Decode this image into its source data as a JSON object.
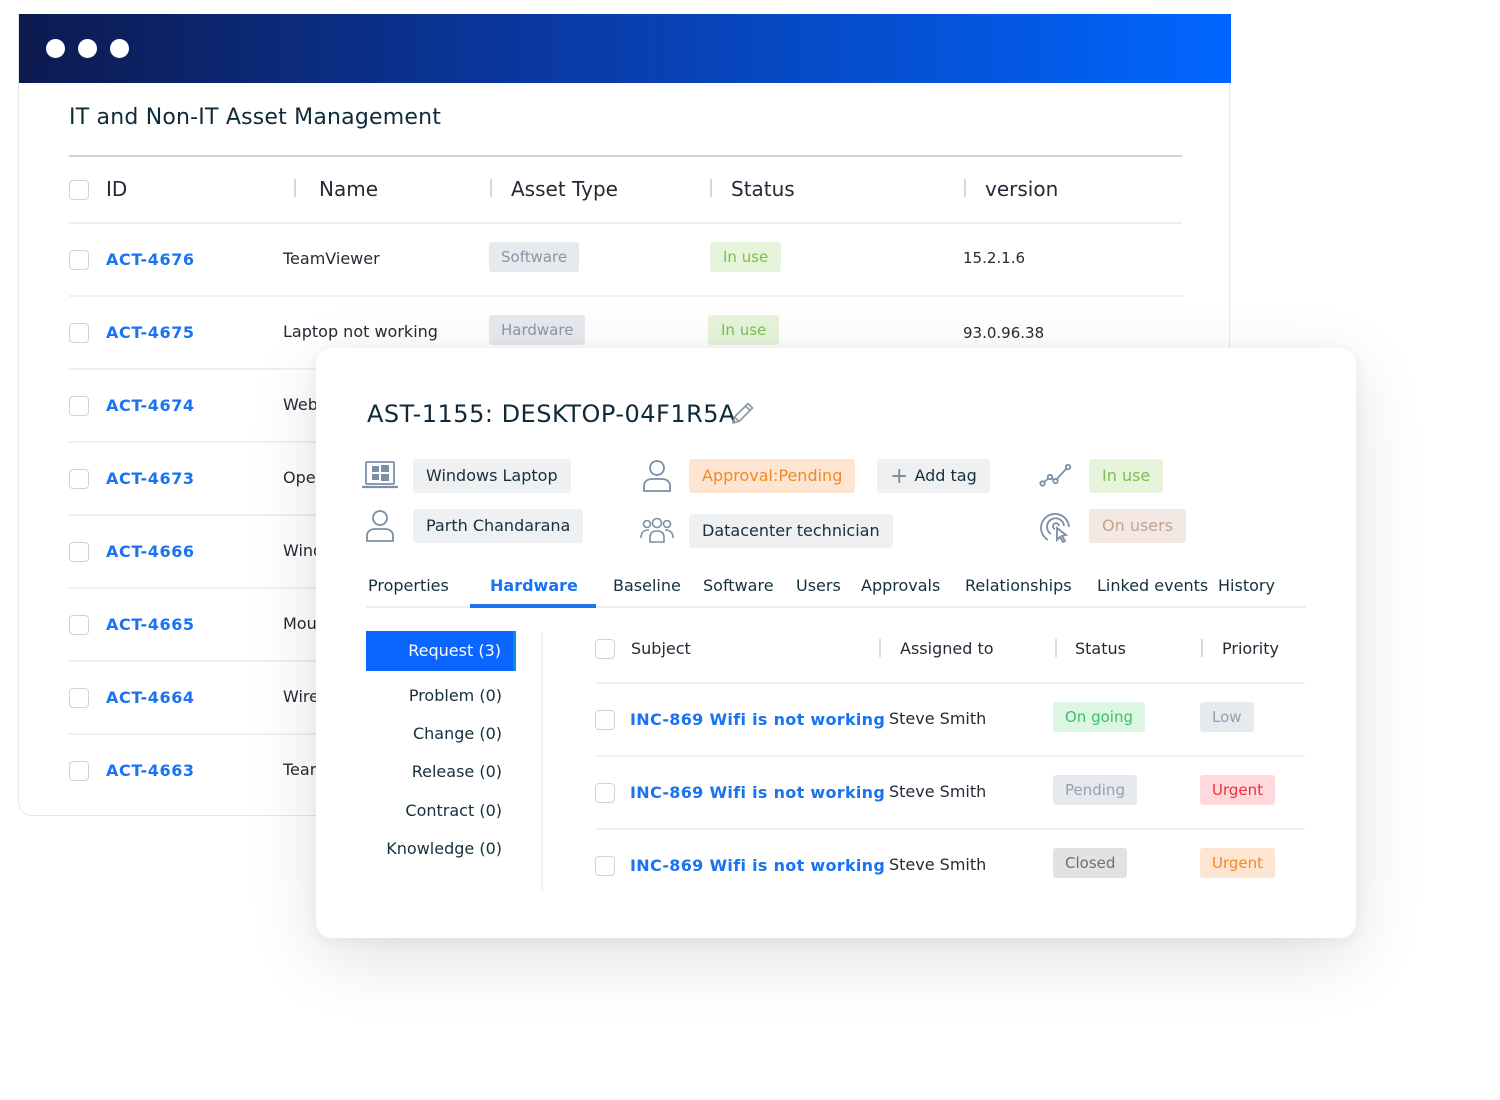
{
  "window": {
    "title": "IT and Non-IT Asset Management",
    "controls": [
      "dot",
      "dot",
      "dot"
    ]
  },
  "asset_table": {
    "columns": [
      "ID",
      "Name",
      "Asset Type",
      "Status",
      "version"
    ],
    "rows": [
      {
        "id": "ACT-4676",
        "name": "TeamViewer",
        "type": "Software",
        "status": "In use",
        "version": "15.2.1.6"
      },
      {
        "id": "ACT-4675",
        "name": "Laptop not working",
        "type": "Hardware",
        "status": "In use",
        "version": "93.0.96.38"
      },
      {
        "id": "ACT-4674",
        "name": "Web",
        "type": "",
        "status": "",
        "version": ""
      },
      {
        "id": "ACT-4673",
        "name": "Ope",
        "type": "",
        "status": "",
        "version": ""
      },
      {
        "id": "ACT-4666",
        "name": "Wind",
        "type": "",
        "status": "",
        "version": ""
      },
      {
        "id": "ACT-4665",
        "name": "Mou",
        "type": "",
        "status": "",
        "version": ""
      },
      {
        "id": "ACT-4664",
        "name": "Wire",
        "type": "",
        "status": "",
        "version": ""
      },
      {
        "id": "ACT-4663",
        "name": "Tear",
        "type": "",
        "status": "",
        "version": ""
      }
    ]
  },
  "asset_detail": {
    "title": "AST-1155: DESKTOP-04F1R5A",
    "edit_icon": "pencil-icon",
    "meta": {
      "device": {
        "icon": "windows-laptop-icon",
        "label": "Windows Laptop"
      },
      "owner": {
        "icon": "user-icon",
        "label": "Parth Chandarana"
      },
      "approval": {
        "icon": "user-icon",
        "label": "Approval:Pending"
      },
      "add_tag": {
        "icon": "plus-icon",
        "label": "Add tag"
      },
      "group": {
        "icon": "users-group-icon",
        "label": "Datacenter technician"
      },
      "lifecycle": {
        "icon": "trend-line-icon",
        "label": "In use"
      },
      "usage": {
        "icon": "target-cursor-icon",
        "label": "On users"
      }
    },
    "tabs": [
      {
        "label": "Properties",
        "active": false
      },
      {
        "label": "Hardware",
        "active": true
      },
      {
        "label": "Baseline",
        "active": false
      },
      {
        "label": "Software",
        "active": false
      },
      {
        "label": "Users",
        "active": false
      },
      {
        "label": "Approvals",
        "active": false
      },
      {
        "label": "Relationships",
        "active": false
      },
      {
        "label": "Linked events",
        "active": false
      },
      {
        "label": "History",
        "active": false
      }
    ],
    "side_menu": [
      {
        "label": "Request (3)",
        "active": true
      },
      {
        "label": "Problem (0)",
        "active": false
      },
      {
        "label": "Change (0)",
        "active": false
      },
      {
        "label": "Release (0)",
        "active": false
      },
      {
        "label": "Contract (0)",
        "active": false
      },
      {
        "label": "Knowledge (0)",
        "active": false
      }
    ],
    "tickets": {
      "columns": [
        "Subject",
        "Assigned to",
        "Status",
        "Priority"
      ],
      "rows": [
        {
          "subject": "INC-869 Wifi is not working",
          "assigned_to": "Steve Smith",
          "status": "On going",
          "priority": "Low"
        },
        {
          "subject": "INC-869 Wifi is not working",
          "assigned_to": "Steve Smith",
          "status": "Pending",
          "priority": "Urgent"
        },
        {
          "subject": "INC-869 Wifi is not working",
          "assigned_to": "Steve Smith",
          "status": "Closed",
          "priority": "Urgent"
        }
      ]
    }
  },
  "colors": {
    "accent": "#1a73f0",
    "titlebar_start": "#0c1a4f",
    "titlebar_end": "#0066ff",
    "in_use_text": "#7cc04f",
    "approval_text": "#f08a24",
    "ongoing_text": "#3cbf63",
    "urgent_red": "#ee2e3a",
    "urgent_orange": "#f08a24"
  }
}
